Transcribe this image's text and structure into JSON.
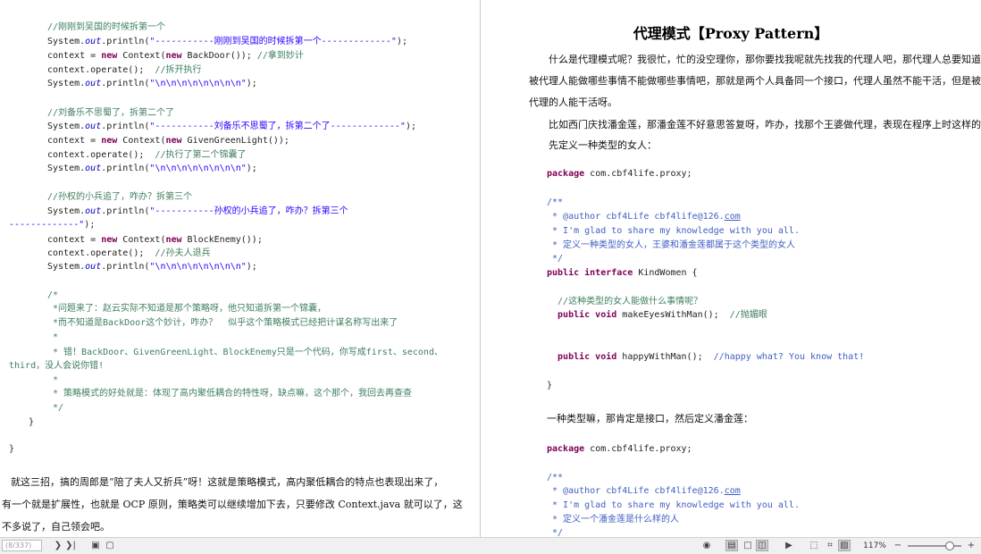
{
  "left_page": {
    "lines": [
      [
        [
          "cm",
          "//刚刚到吴国的时候拆第一个"
        ]
      ],
      [
        [
          "",
          "System."
        ],
        [
          "it",
          "out"
        ],
        [
          "",
          ".println("
        ],
        [
          "st",
          "\"-----------刚刚到吴国的时候拆第一个-------------\""
        ],
        [
          "",
          ");"
        ]
      ],
      [
        [
          "",
          "context = "
        ],
        [
          "kw",
          "new"
        ],
        [
          "",
          " Context("
        ],
        [
          "kw",
          "new"
        ],
        [
          "",
          " BackDoor()); "
        ],
        [
          "cm",
          "//拿到妙计"
        ]
      ],
      [
        [
          "",
          "context.operate();  "
        ],
        [
          "cm",
          "//拆开执行"
        ]
      ],
      [
        [
          "",
          "System."
        ],
        [
          "it",
          "out"
        ],
        [
          "",
          ".println("
        ],
        [
          "st",
          "\"\\n\\n\\n\\n\\n\\n\\n\\n\""
        ],
        [
          "",
          ");"
        ]
      ],
      [],
      [
        [
          "cm",
          "//刘备乐不思蜀了，拆第二个了"
        ]
      ],
      [
        [
          "",
          "System."
        ],
        [
          "it",
          "out"
        ],
        [
          "",
          ".println("
        ],
        [
          "st",
          "\"-----------刘备乐不思蜀了，拆第二个了-------------\""
        ],
        [
          "",
          ");"
        ]
      ],
      [
        [
          "",
          "context = "
        ],
        [
          "kw",
          "new"
        ],
        [
          "",
          " Context("
        ],
        [
          "kw",
          "new"
        ],
        [
          "",
          " GivenGreenLight());"
        ]
      ],
      [
        [
          "",
          "context.operate();  "
        ],
        [
          "cm",
          "//执行了第二个锦囊了"
        ]
      ],
      [
        [
          "",
          "System."
        ],
        [
          "it",
          "out"
        ],
        [
          "",
          ".println("
        ],
        [
          "st",
          "\"\\n\\n\\n\\n\\n\\n\\n\\n\""
        ],
        [
          "",
          ");"
        ]
      ],
      [],
      [
        [
          "cm",
          "//孙权的小兵追了，咋办？拆第三个"
        ]
      ],
      [
        [
          "",
          "System."
        ],
        [
          "it",
          "out"
        ],
        [
          "",
          ".println("
        ],
        [
          "st",
          "\"-----------孙权的小兵追了，咋办？拆第三个"
        ]
      ],
      [
        [
          "st",
          "-------------\""
        ],
        [
          "",
          ");"
        ]
      ],
      [
        [
          "",
          "context = "
        ],
        [
          "kw",
          "new"
        ],
        [
          "",
          " Context("
        ],
        [
          "kw",
          "new"
        ],
        [
          "",
          " BlockEnemy());"
        ]
      ],
      [
        [
          "",
          "context.operate();  "
        ],
        [
          "cm",
          "//孙夫人退兵"
        ]
      ],
      [
        [
          "",
          "System."
        ],
        [
          "it",
          "out"
        ],
        [
          "",
          ".println("
        ],
        [
          "st",
          "\"\\n\\n\\n\\n\\n\\n\\n\\n\""
        ],
        [
          "",
          ");"
        ]
      ],
      [],
      [
        [
          "cm",
          "/*"
        ]
      ],
      [
        [
          "cm",
          " *问题来了：赵云实际不知道是那个策略呀，他只知道拆第一个锦囊，"
        ]
      ],
      [
        [
          "cm",
          " *而不知道是BackDoor这个妙计，咋办？  似乎这个策略模式已经把计谋名称写出来了"
        ]
      ],
      [
        [
          "cm",
          " *"
        ]
      ],
      [
        [
          "cm",
          " * 错！BackDoor、GivenGreenLight、BlockEnemy只是一个代码，你写成first、second、"
        ]
      ],
      [
        [
          "cm",
          "third，没人会说你错!"
        ]
      ],
      [
        [
          "cm",
          " *"
        ]
      ],
      [
        [
          "cm",
          " * 策略模式的好处就是：体现了高内聚低耦合的特性呀，缺点嘛，这个那个，我回去再查查"
        ]
      ],
      [
        [
          "cm",
          " */"
        ]
      ],
      [
        [
          "",
          "}"
        ]
      ],
      [],
      [
        [
          "",
          "}"
        ]
      ]
    ],
    "para": [
      "就这三招，搞的周郎是“陪了夫人又折兵”呀！这就是策略模式，高内聚低耦合的特点也表现出来了，",
      "有一个就是扩展性，也就是 OCP 原则，策略类可以继续增加下去，只要修改 Context.java 就可以了，这",
      "不多说了，自己领会吧。"
    ]
  },
  "right_page": {
    "title": "代理模式【Proxy Pattern】",
    "intro": [
      "什么是代理模式呢？我很忙，忙的没空理你，那你要找我呢就先找我的代理人吧，那代理人总要知道",
      "被代理人能做哪些事情不能做哪些事情吧，那就是两个人具备同一个接口，代理人虽然不能干活，但是被",
      "代理的人能干活呀。",
      "比如西门庆找潘金莲，那潘金莲不好意思答复呀，咋办，找那个王婆做代理，表现在程序上时这样的：",
      "先定义一种类型的女人："
    ],
    "code1": [
      [
        [
          "kw",
          "package"
        ],
        [
          "",
          " com.cbf4life.proxy;"
        ]
      ],
      [],
      [
        [
          "cj",
          "/**"
        ]
      ],
      [
        [
          "cj",
          " * @author cbf4Life cbf4life@126."
        ],
        [
          "lk",
          "com"
        ]
      ],
      [
        [
          "cj",
          " * I'm glad to share my knowledge with you all."
        ]
      ],
      [
        [
          "cj",
          " * 定义一种类型的女人，王婆和潘金莲都属于这个类型的女人"
        ]
      ],
      [
        [
          "cj",
          " */"
        ]
      ],
      [
        [
          "kw",
          "public interface"
        ],
        [
          "",
          " KindWomen {"
        ]
      ],
      [],
      [
        [
          "cm",
          "  //这种类型的女人能做什么事情呢？"
        ]
      ],
      [
        [
          "kw",
          "  public void"
        ],
        [
          "",
          " makeEyesWithMan();  "
        ],
        [
          "cm",
          "//抛媚眼"
        ]
      ],
      [],
      [],
      [
        [
          "kw",
          "  public void"
        ],
        [
          "",
          " happyWithMan();  "
        ],
        [
          "cj",
          "//happy what? You know that!"
        ]
      ],
      [],
      [
        [
          "",
          "}"
        ]
      ]
    ],
    "mid_text": "一种类型嘛，那肯定是接口，然后定义潘金莲：",
    "code2": [
      [
        [
          "kw",
          "package"
        ],
        [
          "",
          " com.cbf4life.proxy;"
        ]
      ],
      [],
      [
        [
          "cj",
          "/**"
        ]
      ],
      [
        [
          "cj",
          " * @author cbf4Life cbf4life@126."
        ],
        [
          "lk",
          "com"
        ]
      ],
      [
        [
          "cj",
          " * I'm glad to share my knowledge with you all."
        ]
      ],
      [
        [
          "cj",
          " * 定义一个潘金莲是什么样的人"
        ]
      ],
      [
        [
          "cj",
          " */"
        ]
      ]
    ]
  },
  "statusbar": {
    "page_indicator": "(8/337)",
    "zoom": "117%"
  }
}
